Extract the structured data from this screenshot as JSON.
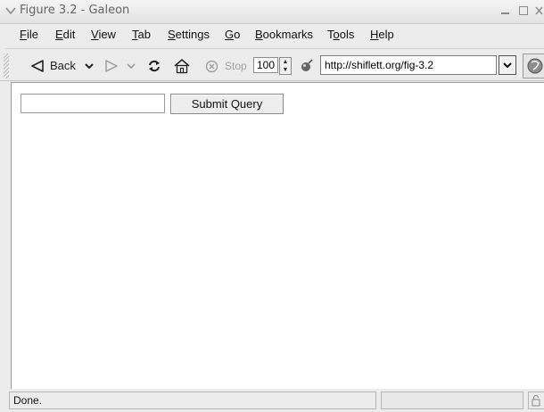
{
  "window": {
    "title": "Figure 3.2 - Galeon",
    "menu_icon": "chevron-down-icon",
    "controls": [
      "minimize-icon",
      "maximize-icon",
      "close-icon"
    ]
  },
  "menu": {
    "items": [
      {
        "label": "File",
        "underline": "F",
        "rest": "ile"
      },
      {
        "label": "Edit",
        "underline": "E",
        "rest": "dit"
      },
      {
        "label": "View",
        "underline": "V",
        "rest": "iew"
      },
      {
        "label": "Tab",
        "underline": "T",
        "rest": "ab"
      },
      {
        "label": "Settings",
        "underline": "S",
        "rest": "ettings"
      },
      {
        "label": "Go",
        "underline": "G",
        "rest": "o"
      },
      {
        "label": "Bookmarks",
        "underline": "B",
        "rest": "ookmarks"
      },
      {
        "label": "Tools",
        "underline_pre": "T",
        "underline": "o",
        "rest": "ols"
      },
      {
        "label": "Help",
        "underline": "H",
        "rest": "elp"
      }
    ]
  },
  "toolbar": {
    "back_label": "Back",
    "stop_label": "Stop",
    "zoom_value": "100",
    "url": "http://shiflett.org/fig-3.2",
    "icons": [
      "back-arrow-icon",
      "forward-arrow-icon",
      "reload-icon",
      "home-icon",
      "stop-icon",
      "zoom-icon",
      "go-icon"
    ]
  },
  "page": {
    "input_value": "",
    "submit_label": "Submit Query"
  },
  "status": {
    "text": "Done.",
    "progress": 0
  },
  "colors": {
    "chrome": "#ececec",
    "content_bg": "#ffffff",
    "progress_fill": "#6b8fc4"
  }
}
